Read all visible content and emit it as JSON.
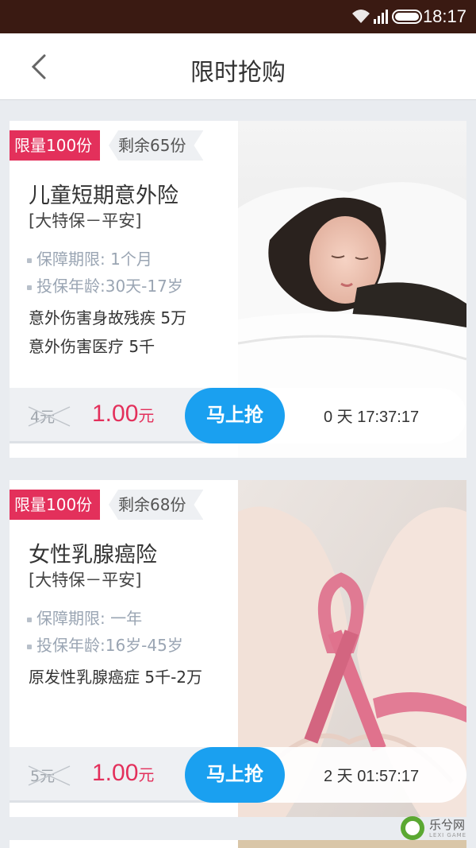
{
  "status_bar": {
    "time": "18:17"
  },
  "header": {
    "title": "限时抢购"
  },
  "products": [
    {
      "limit": "限量100份",
      "remaining": "剩余65份",
      "name": "儿童短期意外险",
      "company": "[大特保－平安]",
      "period": "保障期限: 1个月",
      "age": "投保年龄:30天-17岁",
      "coverage": [
        "意外伤害身故残疾 5万",
        "意外伤害医疗 5千"
      ],
      "old_price": "4元",
      "new_price": "1.00",
      "new_price_unit": "元",
      "buy_label": "马上抢",
      "countdown": "0 天 17:37:17",
      "image": "sleeping-child-photo"
    },
    {
      "limit": "限量100份",
      "remaining": "剩余68份",
      "name": "女性乳腺癌险",
      "company": "[大特保－平安]",
      "period": "保障期限: 一年",
      "age": "投保年龄:16岁-45岁",
      "coverage": [
        "原发性乳腺癌症 5千-2万"
      ],
      "old_price": "5元",
      "new_price": "1.00",
      "new_price_unit": "元",
      "buy_label": "马上抢",
      "countdown": "2 天 01:57:17",
      "image": "pink-ribbon-hands-photo"
    }
  ],
  "watermark": {
    "text": "乐兮网",
    "sub": "LEXI GAME"
  }
}
